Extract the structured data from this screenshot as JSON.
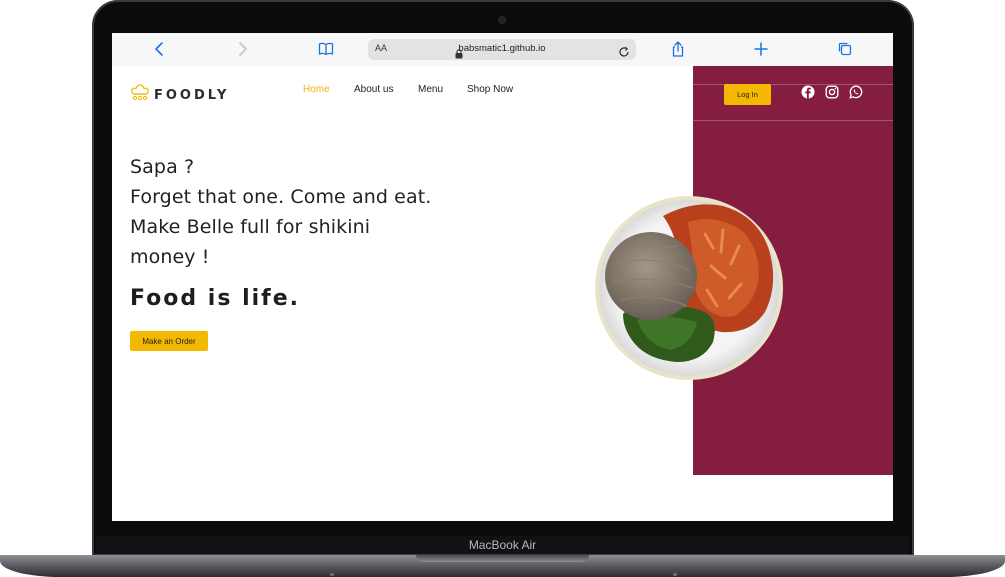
{
  "device": {
    "model_label": "MacBook Air"
  },
  "browser": {
    "address_bar": {
      "text_size_label": "AA",
      "url": "babsmatic1.github.io"
    },
    "icons": [
      "back-icon",
      "forward-icon",
      "bookmarks-icon",
      "lock-icon",
      "reload-icon",
      "share-icon",
      "new-tab-icon",
      "tabs-icon"
    ]
  },
  "site": {
    "logo_text": "FOODLY",
    "nav": {
      "home": "Home",
      "about": "About us",
      "menu": "Menu",
      "shop": "Shop Now"
    },
    "login_label": "Log In",
    "social_icons": [
      "facebook-icon",
      "instagram-icon",
      "whatsapp-icon"
    ],
    "hero": {
      "line1": "Sapa ?",
      "line2": "Forget that one. Come and eat.",
      "line3": "Make Belle full for shikini",
      "line4": "money !"
    },
    "tagline": "Food is life.",
    "cta_label": "Make an Order"
  },
  "colors": {
    "accent_yellow": "#f5b800",
    "nav_active": "#f4b400",
    "side_panel": "#841d40",
    "text_dark": "#222222"
  }
}
